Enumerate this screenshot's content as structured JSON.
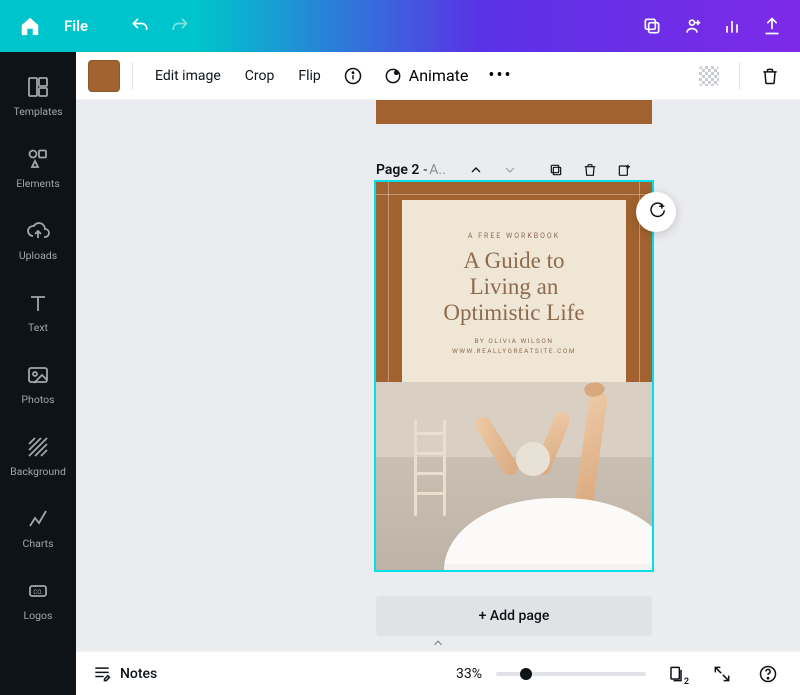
{
  "header": {
    "file_label": "File"
  },
  "sidebar": {
    "items": [
      {
        "label": "Templates"
      },
      {
        "label": "Elements"
      },
      {
        "label": "Uploads"
      },
      {
        "label": "Text"
      },
      {
        "label": "Photos"
      },
      {
        "label": "Background"
      },
      {
        "label": "Charts"
      },
      {
        "label": "Logos"
      }
    ]
  },
  "ctx": {
    "swatch_color": "#a1622f",
    "edit_image": "Edit image",
    "crop": "Crop",
    "flip": "Flip",
    "animate": "Animate"
  },
  "page": {
    "number_label": "Page 2",
    "separator": " - ",
    "title_truncated": "A..",
    "content": {
      "eyebrow": "A FREE WORKBOOK",
      "title_line1": "A Guide to",
      "title_line2": "Living an",
      "title_line3": "Optimistic Life",
      "byline1": "BY OLIVIA WILSON",
      "byline2": "WWW.REALLYGREATSITE.COM"
    }
  },
  "add_page_label": "+ Add page",
  "bottom": {
    "notes": "Notes",
    "zoom_pct": "33%",
    "page_count": "2"
  }
}
